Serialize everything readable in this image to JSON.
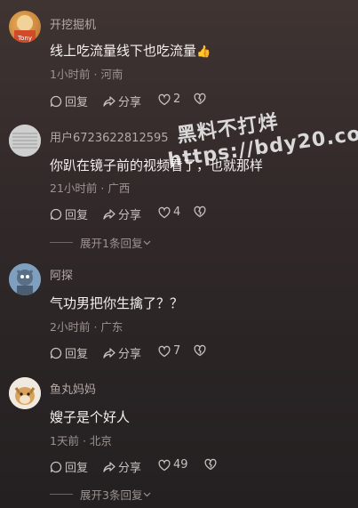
{
  "comments": [
    {
      "username": "开挖掘机",
      "content": "线上吃流量线下也吃流量",
      "emoji": "👍",
      "time": "1小时前",
      "location": "河南",
      "reply": "回复",
      "share": "分享",
      "likes": "2"
    },
    {
      "username": "用户6723622812595",
      "content": "你趴在镜子前的视频看了，也就那样",
      "time": "21小时前",
      "location": "广西",
      "reply": "回复",
      "share": "分享",
      "likes": "4",
      "expand": "展开1条回复"
    },
    {
      "username": "阿探",
      "content": "气功男把你生擒了？？",
      "time": "2小时前",
      "location": "广东",
      "reply": "回复",
      "share": "分享",
      "likes": "7"
    },
    {
      "username": "鱼丸妈妈",
      "content": "嫂子是个好人",
      "time": "1天前",
      "location": "北京",
      "reply": "回复",
      "share": "分享",
      "likes": "49",
      "expand": "展开3条回复"
    }
  ],
  "meta_separator": "·",
  "avatar_text": "Tony",
  "watermark": {
    "line1": "黑料不打烊",
    "line2": "https://bdy20.co"
  }
}
